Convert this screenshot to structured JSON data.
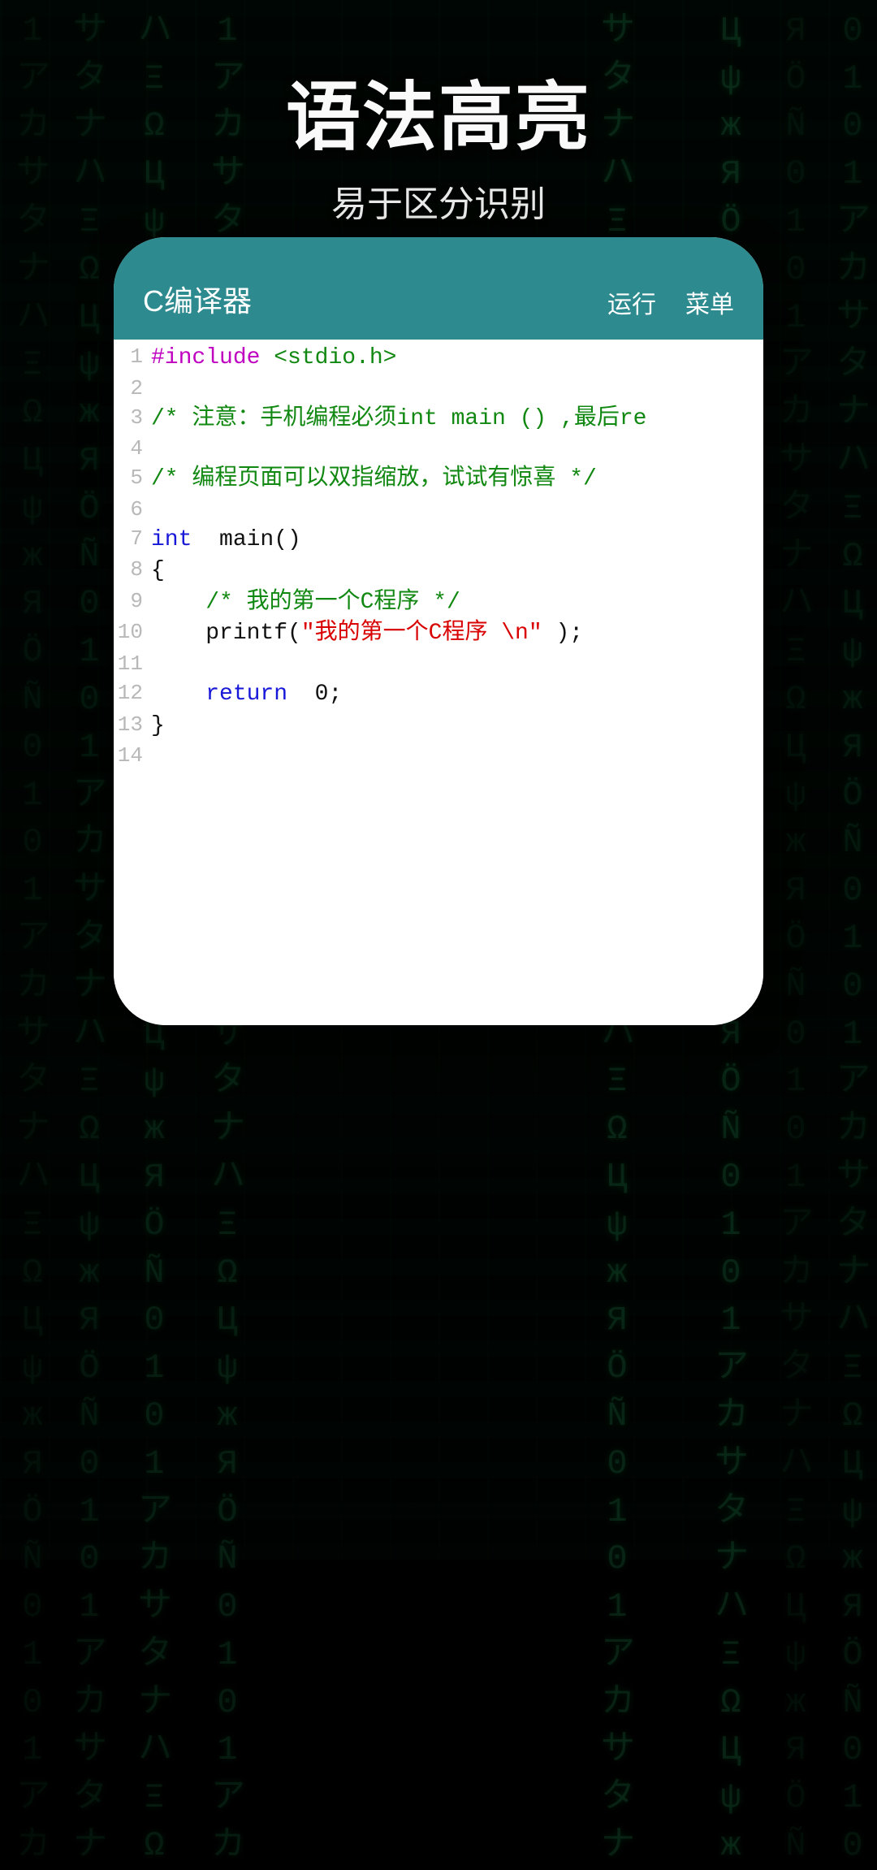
{
  "header": {
    "title": "语法高亮",
    "subtitle": "易于区分识别"
  },
  "app": {
    "title": "C编译器",
    "actions": {
      "run": "运行",
      "menu": "菜单"
    }
  },
  "code": {
    "lines": [
      {
        "n": "1",
        "parts": [
          {
            "cls": "tok-preproc",
            "t": "#include "
          },
          {
            "cls": "tok-header",
            "t": "<stdio.h>"
          }
        ]
      },
      {
        "n": "2",
        "parts": []
      },
      {
        "n": "3",
        "parts": [
          {
            "cls": "tok-comment",
            "t": "/* 注意：手机编程必须int main () ,最后re"
          }
        ]
      },
      {
        "n": "4",
        "parts": []
      },
      {
        "n": "5",
        "parts": [
          {
            "cls": "tok-comment",
            "t": "/* 编程页面可以双指缩放，试试有惊喜 */"
          }
        ]
      },
      {
        "n": "6",
        "parts": []
      },
      {
        "n": "7",
        "parts": [
          {
            "cls": "tok-keyword",
            "t": "int "
          },
          {
            "cls": "tok-plain",
            "t": " main()"
          }
        ]
      },
      {
        "n": "8",
        "parts": [
          {
            "cls": "tok-plain",
            "t": "{"
          }
        ]
      },
      {
        "n": "9",
        "parts": [
          {
            "cls": "tok-plain",
            "t": "    "
          },
          {
            "cls": "tok-comment",
            "t": "/* 我的第一个C程序 */"
          }
        ]
      },
      {
        "n": "10",
        "parts": [
          {
            "cls": "tok-plain",
            "t": "    printf("
          },
          {
            "cls": "tok-string",
            "t": "\"我的第一个C程序 \\n\" "
          },
          {
            "cls": "tok-plain",
            "t": ");"
          }
        ]
      },
      {
        "n": "11",
        "parts": []
      },
      {
        "n": "12",
        "parts": [
          {
            "cls": "tok-plain",
            "t": "    "
          },
          {
            "cls": "tok-keyword",
            "t": "return "
          },
          {
            "cls": "tok-plain",
            "t": " 0;"
          }
        ]
      },
      {
        "n": "13",
        "parts": [
          {
            "cls": "tok-plain",
            "t": "}"
          }
        ]
      },
      {
        "n": "14",
        "parts": []
      }
    ]
  },
  "matrix_glyphs": "0 1 ア カ サ タ ナ ハ Ξ Ω Ц ψ ж Я Ö Ñ 0 1"
}
